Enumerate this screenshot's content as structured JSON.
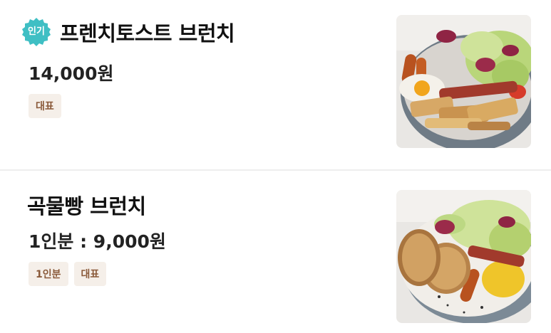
{
  "menu": {
    "items": [
      {
        "badge": "인기",
        "name": "프렌치토스트 브런치",
        "price": "14,000원",
        "tags": [
          "대표"
        ],
        "image": "french-toast-brunch-photo"
      },
      {
        "name": "곡물빵 브런치",
        "price": "1인분 : 9,000원",
        "tags": [
          "1인분",
          "대표"
        ],
        "image": "grain-bread-brunch-photo"
      }
    ]
  },
  "colors": {
    "badge_teal": "#3fbfc4",
    "tag_bg": "#f5efe9",
    "tag_text": "#8a5a3a",
    "divider": "#eeeeee"
  }
}
